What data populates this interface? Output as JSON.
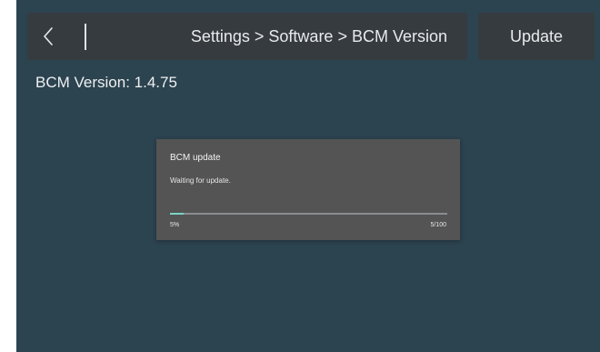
{
  "header": {
    "breadcrumb": "Settings > Software > BCM Version",
    "back_icon": "chevron-left-icon"
  },
  "update_button_label": "Update",
  "bcm_version_text": "BCM Version: 1.4.75",
  "dialog": {
    "title": "BCM update",
    "message": "Waiting for update.",
    "progress_fraction": 0.05,
    "percent_text": "5%",
    "count_text": "5/100"
  },
  "colors": {
    "background": "#2c4350",
    "header_bg": "#353b3f",
    "dialog_bg": "#545454",
    "progress_accent": "#77d4c4"
  }
}
